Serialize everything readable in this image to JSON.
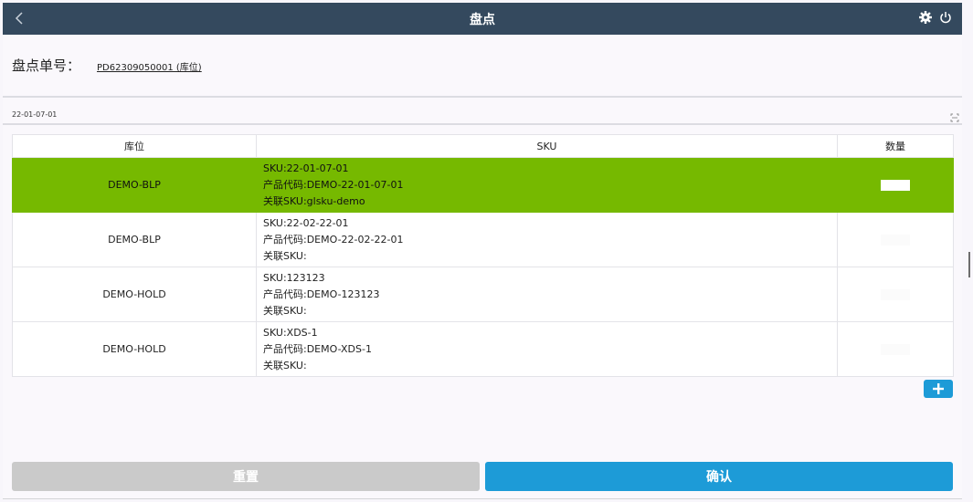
{
  "header": {
    "title": "盘点"
  },
  "order": {
    "label": "盘点单号：",
    "number": "PD62309050001 (库位)"
  },
  "scan": {
    "value": "22-01-07-01"
  },
  "table": {
    "columns": [
      "库位",
      "SKU",
      "数量"
    ],
    "rows": [
      {
        "location": "DEMO-BLP",
        "sku": "SKU:22-01-07-01",
        "product_code": "产品代码:DEMO-22-01-07-01",
        "related_sku": "关联SKU:glsku-demo",
        "selected": true
      },
      {
        "location": "DEMO-BLP",
        "sku": "SKU:22-02-22-01",
        "product_code": "产品代码:DEMO-22-02-22-01",
        "related_sku": "关联SKU:",
        "selected": false
      },
      {
        "location": "DEMO-HOLD",
        "sku": "SKU:123123",
        "product_code": "产品代码:DEMO-123123",
        "related_sku": "关联SKU:",
        "selected": false
      },
      {
        "location": "DEMO-HOLD",
        "sku": "SKU:XDS-1",
        "product_code": "产品代码:DEMO-XDS-1",
        "related_sku": "关联SKU:",
        "selected": false
      }
    ]
  },
  "actions": {
    "reset_label": "重置",
    "confirm_label": "确认"
  },
  "icons": {
    "back": "chevron-left-icon",
    "settings": "gear-icon",
    "power": "power-icon",
    "scan": "scan-frame-icon",
    "add": "plus-icon"
  },
  "colors": {
    "header": "#34495e",
    "selected_row": "#76b900",
    "primary": "#1d9bd7",
    "disabled": "#cacaca"
  }
}
